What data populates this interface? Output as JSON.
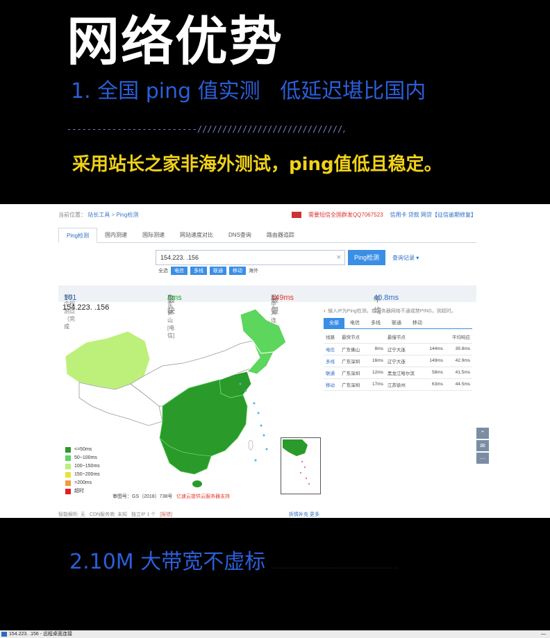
{
  "banner": {
    "title": "网络优势",
    "subtitle": "1. 全国 ping 值实测   低延迟堪比国内",
    "divider": "--------------------------////////////////////////////////////////////////--------------------",
    "description": "采用站长之家非海外测试，ping值低且稳定。"
  },
  "screenshot": {
    "breadcrumb": {
      "prefix": "当前位置：",
      "item1": "站长工具",
      "sep": ">",
      "item2": "Ping检测"
    },
    "topbar_ad": "需要短信全国群发QQ7067523",
    "topbar_links": "信用卡 贷款 网贷【征信逾期修复】",
    "tabs": [
      "Ping检测",
      "国内测速",
      "国际测速",
      "网站速度对比",
      "DNS查询",
      "路由器追踪"
    ],
    "search": {
      "value": "154.223.      .156",
      "button": "Ping检测",
      "history": "查询记录 ▾"
    },
    "filter": {
      "label": "全选",
      "chips": [
        "电信",
        "多线",
        "联通",
        "移动"
      ],
      "extra": "海外"
    },
    "stats": {
      "probe_prefix": "101个探测点（完成",
      "probe_count": "101",
      "probe_suffix": "个）",
      "fastest_label": "最快",
      "fastest_loc": "广东佛山[电信]",
      "fastest_val": "8ms",
      "slowest_label": "最慢",
      "slowest_loc": "辽宁大连[多线]",
      "slowest_val": "149ms",
      "avg_label": "平均",
      "avg_val": "40.8ms"
    },
    "ip_label": "154.223.      .156",
    "legend": [
      {
        "label": "<=50ms",
        "color": "#2a9a2a"
      },
      {
        "label": "50~100ms",
        "color": "#5cd65c"
      },
      {
        "label": "100~150ms",
        "color": "#bdf07a"
      },
      {
        "label": "150~200ms",
        "color": "#e8e23a"
      },
      {
        "label": ">200ms",
        "color": "#f09a3a"
      },
      {
        "label": "超时",
        "color": "#e02020"
      }
    ],
    "map_no": "审图号：GS（2018）738号",
    "map_ad": "亿速云提供云服务器支持",
    "notice_icon": "◐",
    "notice": "输入IP为Ping检测，若服务器网络不通或禁PING，则超时。",
    "result_tabs": [
      "全部",
      "电信",
      "多线",
      "联通",
      "移动"
    ],
    "table_headers": [
      "线路",
      "最快节点",
      "",
      "最慢节点",
      "",
      "平均响应"
    ],
    "table_rows": [
      [
        "电信",
        "广东佛山",
        "8ms",
        "辽宁大连",
        "144ms",
        "39.8ms"
      ],
      [
        "多线",
        "广东深圳",
        "16ms",
        "辽宁大连",
        "149ms",
        "42.9ms"
      ],
      [
        "联通",
        "广东深圳",
        "12ms",
        "黑龙江哈尔滨",
        "58ms",
        "41.5ms"
      ],
      [
        "移动",
        "广东深圳",
        "17ms",
        "江苏徐州",
        "63ms",
        "44.5ms"
      ]
    ],
    "bottom": {
      "dns": "智能解析: 无",
      "cdn": "CDN服务商: 未知",
      "ip": "独立IP 1 个",
      "report": "[报错]",
      "right": "拆情补充    更多"
    },
    "side_icons": [
      "chevron-up-icon",
      "chat-icon",
      "more-icon"
    ],
    "side_glyphs": [
      "⌃",
      "✉",
      "⋯"
    ]
  },
  "section2": {
    "subtitle": "2.10M 大带宽不虚标",
    "faded": "................................................"
  },
  "taskbar": {
    "title": "154.223.      .156 - 远程桌面连接",
    "end": "—"
  }
}
